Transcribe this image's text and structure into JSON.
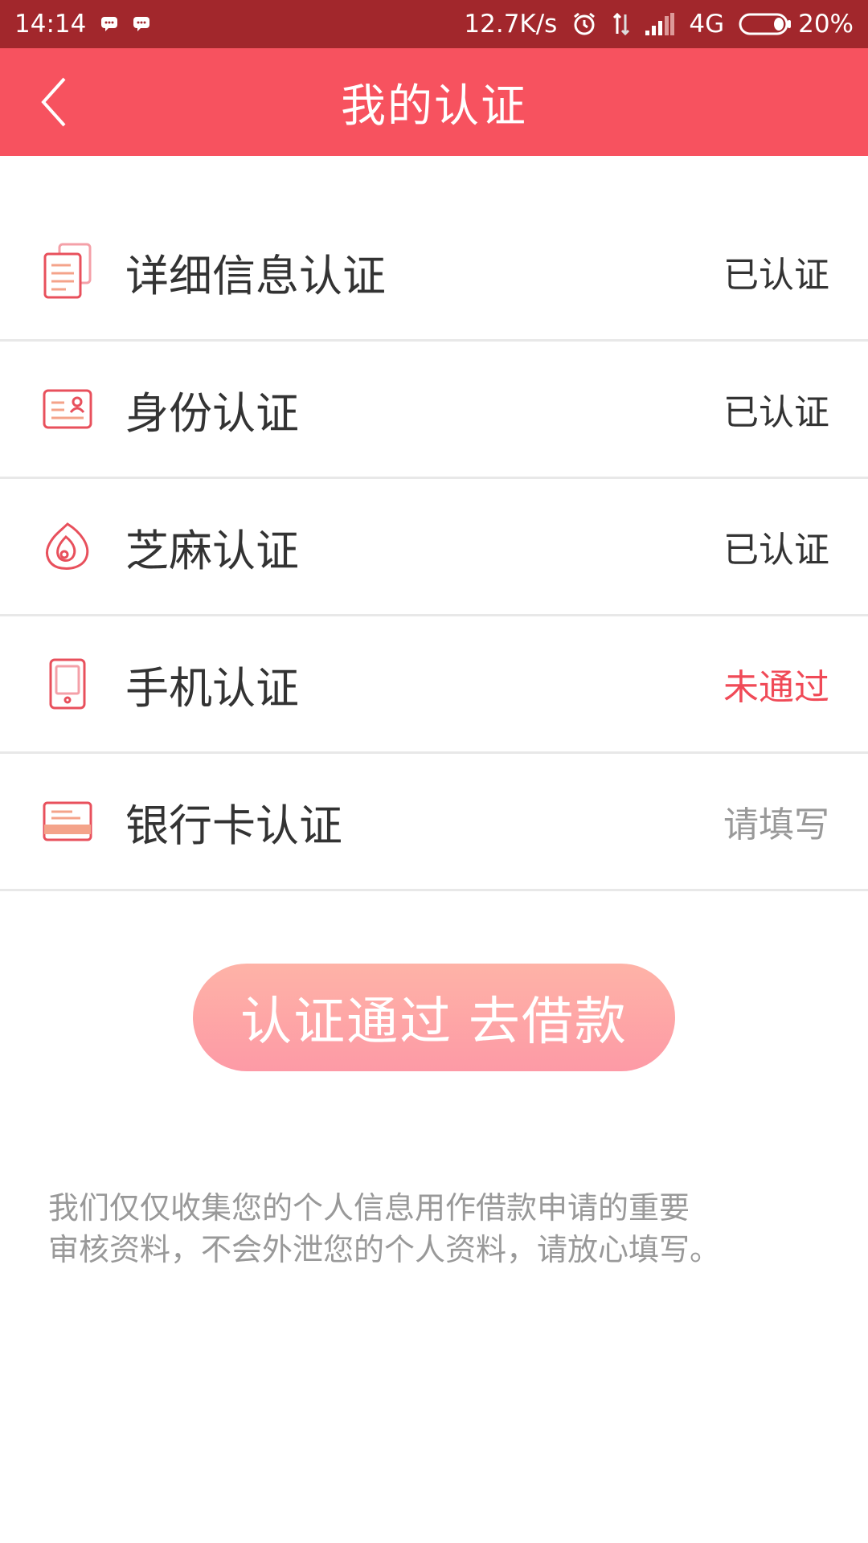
{
  "status_bar": {
    "time": "14:14",
    "speed": "12.7K/s",
    "network": "4G",
    "battery": "20%"
  },
  "header": {
    "title": "我的认证",
    "back_icon": "chevron-left-icon"
  },
  "items": [
    {
      "label": "详细信息认证",
      "status": "已认证",
      "icon": "document-icon"
    },
    {
      "label": "身份认证",
      "status": "已认证",
      "icon": "id-card-icon"
    },
    {
      "label": "芝麻认证",
      "status": "已认证",
      "icon": "sesame-icon"
    },
    {
      "label": "手机认证",
      "status": "未通过",
      "icon": "phone-icon"
    },
    {
      "label": "银行卡认证",
      "status": "请填写",
      "icon": "bank-card-icon"
    }
  ],
  "cta": {
    "label": "认证通过 去借款"
  },
  "notice": {
    "line1": "我们仅仅收集您的个人信息用作借款申请的重要",
    "line2": "审核资料，不会外泄您的个人资料，请放心填写。"
  },
  "colors": {
    "status_bar": "#a2272c",
    "header": "#f7525f",
    "accent": "#f04a57",
    "muted": "#999999"
  }
}
